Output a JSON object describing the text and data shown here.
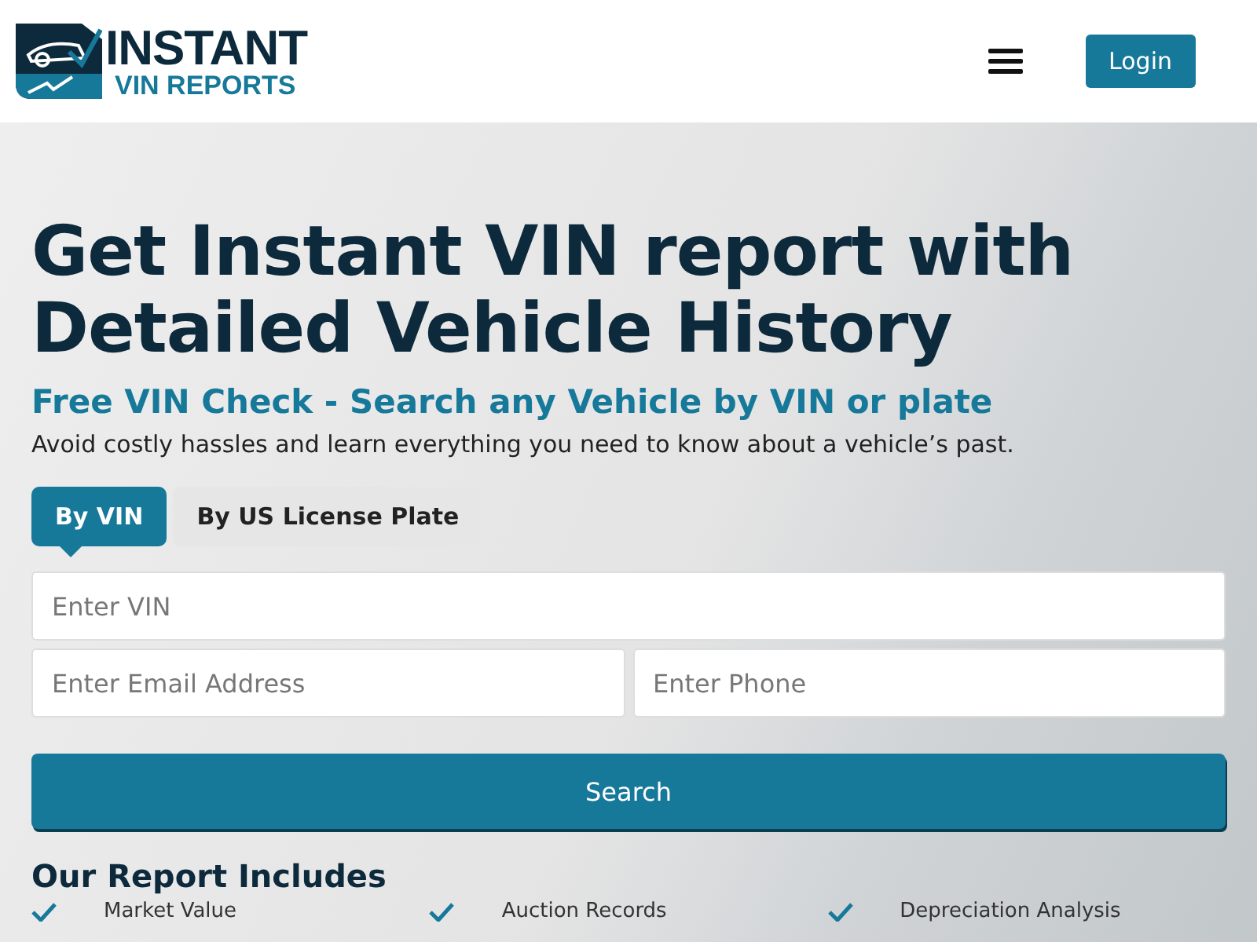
{
  "header": {
    "logo": {
      "line_1": "INSTANT",
      "line_2": "VIN REPORTS"
    },
    "login": "Login"
  },
  "hero": {
    "title": "Get Instant VIN report with Detailed Vehicle History",
    "subtitle": "Free VIN Check - Search any Vehicle by VIN or plate",
    "description": "Avoid costly hassles and learn everything you need to know about a vehicle’s past."
  },
  "tabs": [
    {
      "label": "By VIN",
      "selected": true
    },
    {
      "label": "By US License Plate",
      "selected": false
    }
  ],
  "form": {
    "vin": {
      "placeholder": "Enter VIN"
    },
    "email": {
      "placeholder": "Enter Email Address"
    },
    "phone": {
      "placeholder": "Enter Phone"
    },
    "submit": "Search"
  },
  "includes": {
    "heading": "Our Report Includes",
    "items": [
      "Market Value",
      "Auction Records",
      "Depreciation Analysis"
    ]
  }
}
